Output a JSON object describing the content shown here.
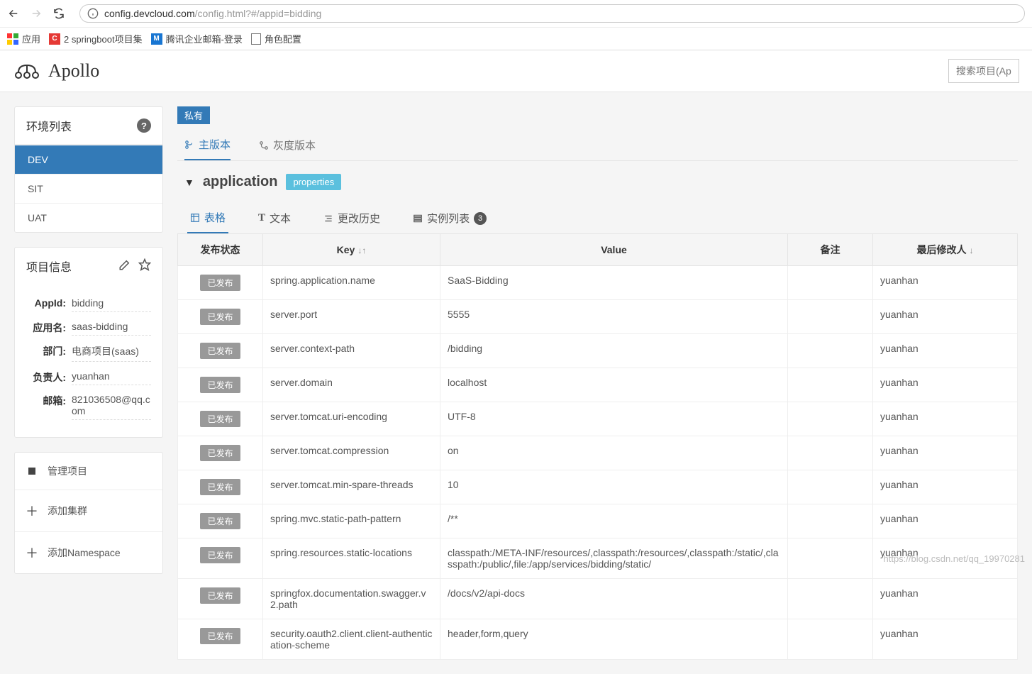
{
  "browser": {
    "url_host": "config.devcloud.com",
    "url_path": "/config.html?#/appid=bidding"
  },
  "bookmarks": {
    "apps": "应用",
    "items": [
      {
        "label": "2 springboot项目集"
      },
      {
        "label": "腾讯企业邮箱-登录"
      },
      {
        "label": "角色配置"
      }
    ]
  },
  "brand": "Apollo",
  "search": {
    "placeholder": "搜索项目(App"
  },
  "sidebar": {
    "env_title": "环境列表",
    "envs": [
      "DEV",
      "SIT",
      "UAT"
    ],
    "project_title": "项目信息",
    "project": {
      "appid_label": "AppId:",
      "appid": "bidding",
      "name_label": "应用名:",
      "name": "saas-bidding",
      "dept_label": "部门:",
      "dept": "电商项目(saas)",
      "owner_label": "负责人:",
      "owner": "yuanhan",
      "mail_label": "邮箱:",
      "mail": "821036508@qq.com"
    },
    "actions": {
      "manage": "管理项目",
      "add_cluster": "添加集群",
      "add_namespace": "添加Namespace"
    }
  },
  "main": {
    "private_badge": "私有",
    "vtabs": {
      "main": "主版本",
      "gray": "灰度版本"
    },
    "namespace": {
      "name": "application",
      "type": "properties"
    },
    "dtabs": {
      "table": "表格",
      "text": "文本",
      "history": "更改历史",
      "instances": "实例列表",
      "instances_count": "3"
    },
    "columns": {
      "status": "发布状态",
      "key": "Key",
      "value": "Value",
      "remark": "备注",
      "modifier": "最后修改人"
    },
    "published_label": "已发布",
    "rows": [
      {
        "key": "spring.application.name",
        "value": "SaaS-Bidding",
        "modifier": "yuanhan"
      },
      {
        "key": "server.port",
        "value": "5555",
        "modifier": "yuanhan"
      },
      {
        "key": "server.context-path",
        "value": "/bidding",
        "modifier": "yuanhan"
      },
      {
        "key": "server.domain",
        "value": "localhost",
        "modifier": "yuanhan"
      },
      {
        "key": "server.tomcat.uri-encoding",
        "value": "UTF-8",
        "modifier": "yuanhan"
      },
      {
        "key": "server.tomcat.compression",
        "value": "on",
        "modifier": "yuanhan"
      },
      {
        "key": "server.tomcat.min-spare-threads",
        "value": "10",
        "modifier": "yuanhan"
      },
      {
        "key": "spring.mvc.static-path-pattern",
        "value": "/**",
        "modifier": "yuanhan"
      },
      {
        "key": "spring.resources.static-locations",
        "value": "classpath:/META-INF/resources/,classpath:/resources/,classpath:/static/,classpath:/public/,file:/app/services/bidding/static/",
        "modifier": "yuanhan"
      },
      {
        "key": "springfox.documentation.swagger.v2.path",
        "value": "/docs/v2/api-docs",
        "modifier": "yuanhan"
      },
      {
        "key": "security.oauth2.client.client-authentication-scheme",
        "value": "header,form,query",
        "modifier": "yuanhan"
      }
    ]
  },
  "watermark": "https://blog.csdn.net/qq_19970281"
}
